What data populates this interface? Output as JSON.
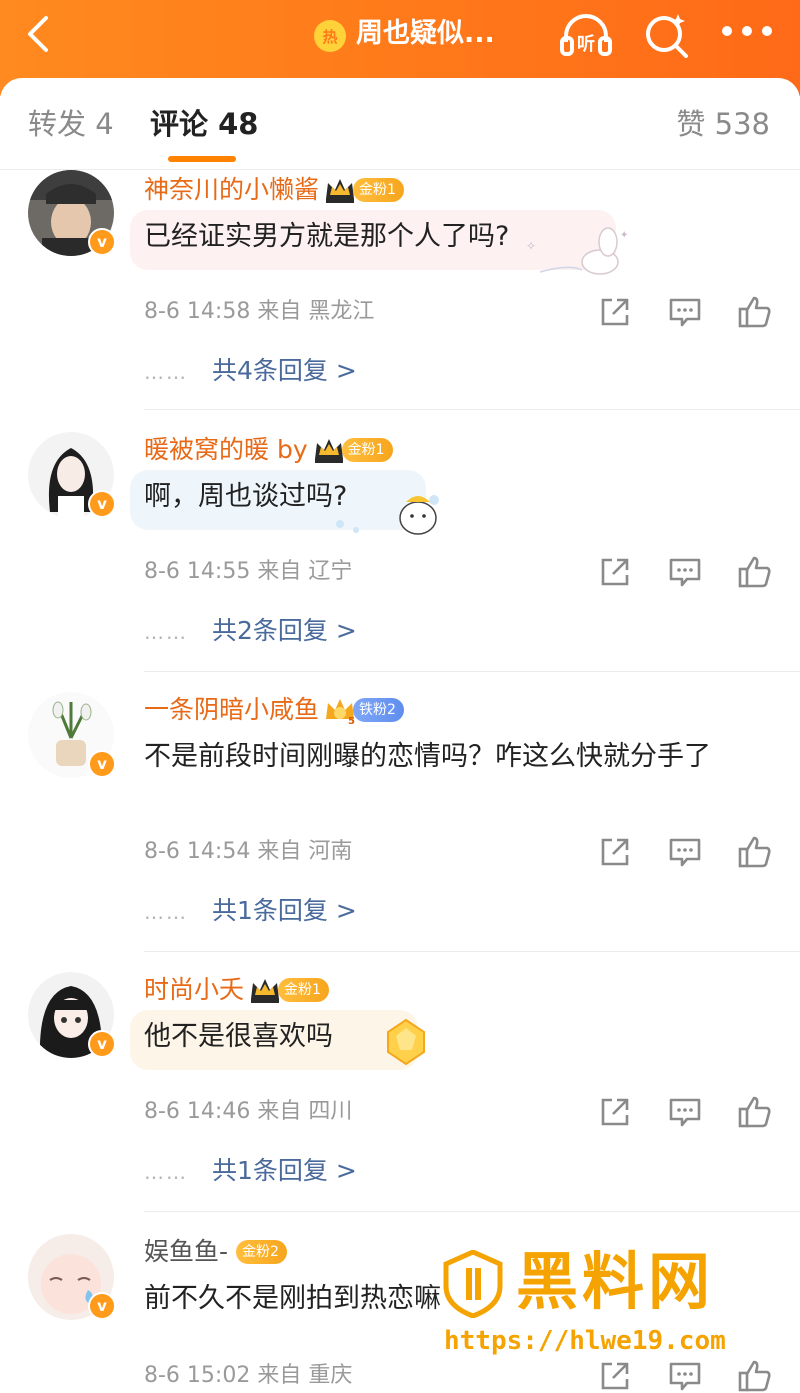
{
  "header": {
    "hot_badge": "热",
    "title": "周也疑似...",
    "listen_label": "听"
  },
  "tabs": {
    "repost": "转发 4",
    "comments": "评论 48",
    "likes": "赞 538"
  },
  "comments": [
    {
      "user": "神奈川的小懒酱",
      "fan_badge": "金粉1",
      "fan_badge_type": "gold",
      "text": "已经证实男方就是那个人了吗?",
      "meta": "8-6 14:58  来自 黑龙江",
      "replies": "共4条回复 >"
    },
    {
      "user": "暖被窝的暖 by",
      "fan_badge": "金粉1",
      "fan_badge_type": "gold",
      "text": "啊，周也谈过吗?",
      "meta": "8-6 14:55  来自 辽宁",
      "replies": "共2条回复 >"
    },
    {
      "user": "一条阴暗小咸鱼",
      "fan_badge": "铁粉2",
      "fan_badge_type": "iron",
      "crown_level": "5",
      "text": "不是前段时间刚曝的恋情吗？咋这么快就分手了",
      "meta": "8-6 14:54  来自 河南",
      "replies": "共1条回复 >"
    },
    {
      "user": "时尚小夭",
      "fan_badge": "金粉1",
      "fan_badge_type": "gold",
      "text": "他不是很喜欢吗",
      "meta": "8-6 14:46  来自 四川",
      "replies": "共1条回复 >"
    },
    {
      "user": "娱鱼鱼-",
      "fan_badge": "金粉2",
      "fan_badge_type": "gold",
      "text": "前不久不是刚拍到热恋嘛",
      "meta": "8-6 15:02  来自 重庆"
    }
  ],
  "dots": "……",
  "vip_mark": "v",
  "watermark": {
    "brand": "黑料网",
    "url": "https://hlwe19.com"
  },
  "colors": {
    "header_orange": "#ff7a1a",
    "username_orange": "#e86a17",
    "reply_link": "#4a6a9c",
    "gold_badge": "#f7a51d",
    "iron_badge": "#5f8ef0"
  }
}
